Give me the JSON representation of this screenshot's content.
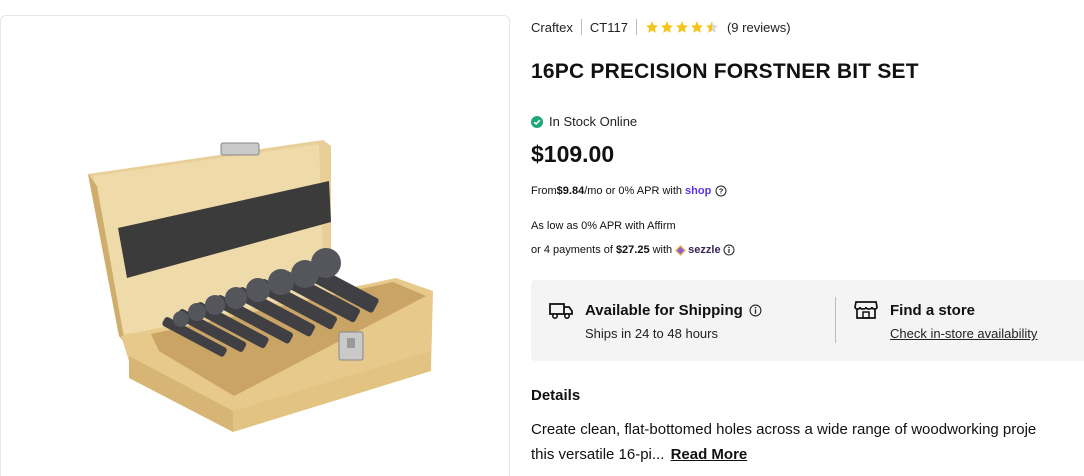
{
  "product_image": {
    "alt": "16PC Precision Forstner Bit Set in wooden case"
  },
  "meta": {
    "brand": "Craftex",
    "model": "CT117",
    "rating": 4.5,
    "rating_max": 5,
    "reviews_text": "(9 reviews)"
  },
  "title": "16PC PRECISION FORSTNER BIT SET",
  "stock": {
    "label": "In Stock Online",
    "color": "#1fa67a"
  },
  "price": "$109.00",
  "financing": {
    "prefix": "From ",
    "monthly": "$9.84",
    "middle": "/mo or 0% APR with",
    "provider": "shop"
  },
  "affirm": "As low as 0% APR with Affirm",
  "sezzle": {
    "prefix": "or 4 payments of",
    "amount": "$27.25",
    "middle": "with",
    "provider": "sezzle"
  },
  "delivery": {
    "shipping": {
      "title": "Available for Shipping",
      "subtitle": "Ships in 24 to 48 hours"
    },
    "store": {
      "title": "Find a store",
      "subtitle": "Check in-store availability"
    }
  },
  "details": {
    "heading": "Details",
    "line1": "Create clean, flat-bottomed holes across a wide range of woodworking proje",
    "line2": "this versatile 16-pi...",
    "read_more": "Read More"
  },
  "colors": {
    "star": "#f5c518",
    "shop": "#5a31f4",
    "sezzle": "#392558"
  }
}
